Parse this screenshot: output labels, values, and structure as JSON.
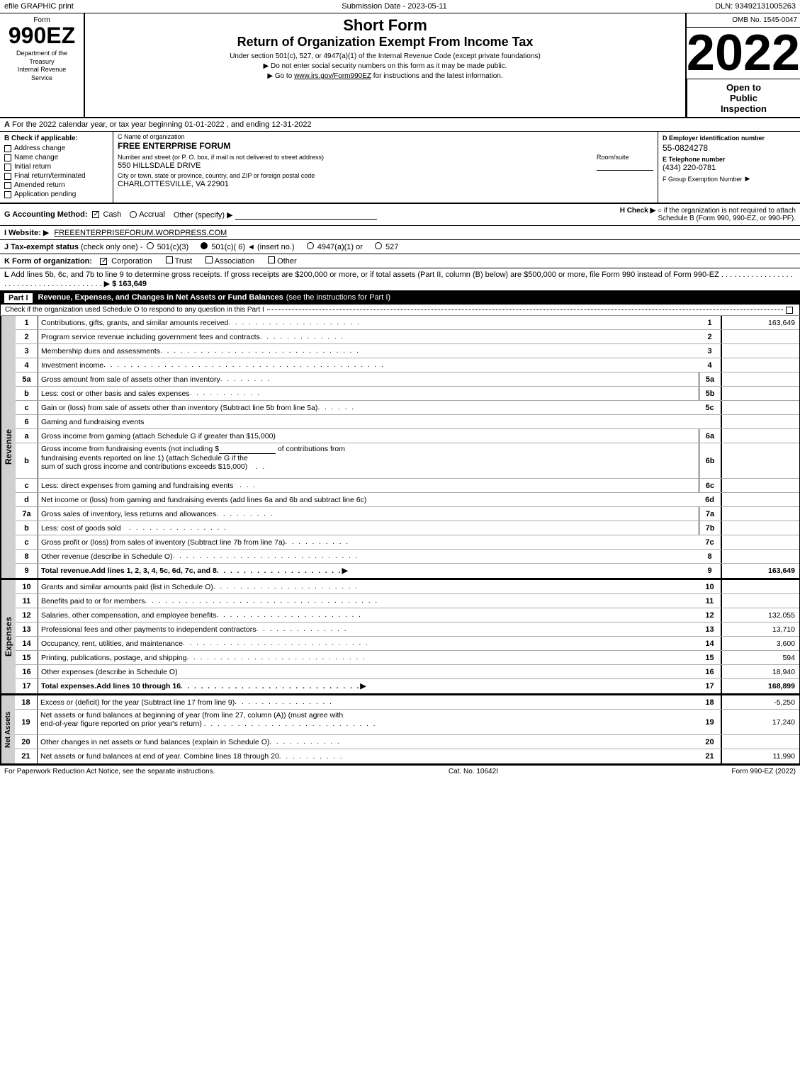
{
  "header": {
    "left": "efile GRAPHIC print",
    "center": "Submission Date - 2023-05-11",
    "right": "DLN: 93492131005263"
  },
  "form": {
    "word": "Form",
    "number": "990EZ",
    "dept_line1": "Department of the",
    "dept_line2": "Treasury",
    "dept_line3": "Internal Revenue",
    "dept_line4": "Service"
  },
  "title": {
    "short_form": "Short Form",
    "return_title": "Return of Organization Exempt From Income Tax",
    "note1": "Under section 501(c), 527, or 4947(a)(1) of the Internal Revenue Code (except private foundations)",
    "note2": "▶ Do not enter social security numbers on this form as it may be made public.",
    "note3": "▶ Go to www.irs.gov/Form990EZ for instructions and the latest information."
  },
  "omb": {
    "label": "OMB No. 1545-0047"
  },
  "year": {
    "value": "2022"
  },
  "open_inspection": {
    "line1": "Open to",
    "line2": "Public",
    "line3": "Inspection"
  },
  "section_a": {
    "label": "A",
    "text": "For the 2022 calendar year, or tax year beginning 01-01-2022 , and ending 12-31-2022"
  },
  "check_b": {
    "title": "B Check if applicable:",
    "items": [
      {
        "label": "Address change",
        "checked": false
      },
      {
        "label": "Name change",
        "checked": false
      },
      {
        "label": "Initial return",
        "checked": false
      },
      {
        "label": "Final return/terminated",
        "checked": false
      },
      {
        "label": "Amended return",
        "checked": false
      },
      {
        "label": "Application pending",
        "checked": false
      }
    ]
  },
  "org": {
    "name_label": "C Name of organization",
    "name": "FREE ENTERPRISE FORUM",
    "address_label": "Number and street (or P. O. box, if mail is not delivered to street address)",
    "address": "550 HILLSDALE DRIVE",
    "room_suite_label": "Room/suite",
    "room_suite": "",
    "city_label": "City or town, state or province, country, and ZIP or foreign postal code",
    "city": "CHARLOTTESVILLE, VA  22901"
  },
  "employer": {
    "label": "D Employer identification number",
    "value": "55-0824278",
    "phone_label": "E Telephone number",
    "phone": "(434) 220-0781",
    "group_exempt_label": "F Group Exemption Number",
    "group_exempt_arrow": "▶"
  },
  "accounting": {
    "label": "G Accounting Method:",
    "cash_checked": true,
    "accrual_checked": false,
    "cash_label": "Cash",
    "accrual_label": "Accrual",
    "other_label": "Other (specify) ▶",
    "h_label": "H  Check ▶",
    "h_text": "○ if the organization is not required to attach Schedule B (Form 990, 990-EZ, or 990-PF)."
  },
  "website": {
    "label": "I Website:",
    "arrow": "▶",
    "value": "FREEENTERPRISEFORUM.WORDPRESS.COM"
  },
  "tax_exempt": {
    "label": "J Tax-exempt status",
    "note": "(check only one) -",
    "option501c3": "○ 501(c)(3)",
    "option501c6": "● 501(c)( 6)",
    "insert_no": "◄ (insert no.)",
    "option4947": "○ 4947(a)(1) or",
    "option527": "○ 527"
  },
  "form_org": {
    "label": "K Form of organization:",
    "corporation_checked": true,
    "trust_checked": false,
    "association_checked": false,
    "other_checked": false,
    "options": [
      "Corporation",
      "Trust",
      "Association",
      "Other"
    ]
  },
  "line_l": {
    "text": "L Add lines 5b, 6c, and 7b to line 9 to determine gross receipts. If gross receipts are $200,000 or more, or if total assets (Part II, column (B) below) are $500,000 or more, file Form 990 instead of Form 990-EZ",
    "dots": ". . . . . . . . . . . . . . . . . . . . . . . . . . . . . . . . . . . . . . . . .",
    "arrow": "▶",
    "value": "$ 163,649"
  },
  "part1": {
    "label": "Part I",
    "title": "Revenue, Expenses, and Changes in Net Assets or Fund Balances",
    "subtitle": "(see the instructions for Part I)",
    "check_note": "Check if the organization used Schedule O to respond to any question in this Part I",
    "rows": [
      {
        "num": "1",
        "desc": "Contributions, gifts, grants, and similar amounts received",
        "dots": true,
        "value": "163,649",
        "bold": false
      },
      {
        "num": "2",
        "desc": "Program service revenue including government fees and contracts",
        "dots": true,
        "value": "",
        "bold": false
      },
      {
        "num": "3",
        "desc": "Membership dues and assessments",
        "dots": true,
        "value": "",
        "bold": false
      },
      {
        "num": "4",
        "desc": "Investment income",
        "dots": true,
        "value": "",
        "bold": false
      },
      {
        "num": "5a",
        "desc": "Gross amount from sale of assets other than inventory",
        "mid_label": "5a",
        "mid_value": "",
        "dots": true,
        "value": "",
        "bold": false
      },
      {
        "num": "b",
        "desc": "Less: cost or other basis and sales expenses",
        "mid_label": "5b",
        "mid_value": "",
        "dots": true,
        "value": "",
        "bold": false
      },
      {
        "num": "c",
        "desc": "Gain or (loss) from sale of assets other than inventory (Subtract line 5b from line 5a)",
        "dots": true,
        "value": "",
        "bold": false,
        "line_num_right": "5c"
      },
      {
        "num": "6",
        "desc": "Gaming and fundraising events",
        "value": "",
        "bold": false
      },
      {
        "num": "a",
        "desc": "Gross income from gaming (attach Schedule G if greater than $15,000)",
        "mid_label": "6a",
        "mid_value": "",
        "dots": false,
        "value": "",
        "bold": false
      },
      {
        "num": "b",
        "desc": "Gross income from fundraising events (not including $_______________of contributions from fundraising events reported on line 1) (attach Schedule G if the sum of such gross income and contributions exceeds $15,000)",
        "mid_label": "6b",
        "mid_value": "",
        "dots": false,
        "value": "",
        "bold": false
      },
      {
        "num": "c",
        "desc": "Less: direct expenses from gaming and fundraising events",
        "mid_label": "6c",
        "mid_value": "",
        "dots": false,
        "value": "",
        "bold": false
      },
      {
        "num": "d",
        "desc": "Net income or (loss) from gaming and fundraising events (add lines 6a and 6b and subtract line 6c)",
        "dots": false,
        "value": "",
        "bold": false,
        "line_num_right": "6d"
      },
      {
        "num": "7a",
        "desc": "Gross sales of inventory, less returns and allowances",
        "mid_label": "7a",
        "mid_value": "",
        "dots": true,
        "value": "",
        "bold": false
      },
      {
        "num": "b",
        "desc": "Less: cost of goods sold",
        "mid_label": "7b",
        "mid_value": "",
        "dots": true,
        "value": "",
        "bold": false
      },
      {
        "num": "c",
        "desc": "Gross profit or (loss) from sales of inventory (Subtract line 7b from line 7a)",
        "dots": true,
        "value": "",
        "bold": false,
        "line_num_right": "7c"
      },
      {
        "num": "8",
        "desc": "Other revenue (describe in Schedule O)",
        "dots": true,
        "value": "",
        "bold": false
      },
      {
        "num": "9",
        "desc": "Total revenue. Add lines 1, 2, 3, 4, 5c, 6d, 7c, and 8",
        "dots": true,
        "value": "163,649",
        "bold": true,
        "arrow": "▶"
      }
    ]
  },
  "expenses_rows": [
    {
      "num": "10",
      "desc": "Grants and similar amounts paid (list in Schedule O)",
      "dots": true,
      "value": "",
      "bold": false
    },
    {
      "num": "11",
      "desc": "Benefits paid to or for members",
      "dots": true,
      "value": "",
      "bold": false
    },
    {
      "num": "12",
      "desc": "Salaries, other compensation, and employee benefits",
      "dots": true,
      "value": "132,055",
      "bold": false
    },
    {
      "num": "13",
      "desc": "Professional fees and other payments to independent contractors",
      "dots": true,
      "value": "13,710",
      "bold": false
    },
    {
      "num": "14",
      "desc": "Occupancy, rent, utilities, and maintenance",
      "dots": true,
      "value": "3,600",
      "bold": false
    },
    {
      "num": "15",
      "desc": "Printing, publications, postage, and shipping",
      "dots": true,
      "value": "594",
      "bold": false
    },
    {
      "num": "16",
      "desc": "Other expenses (describe in Schedule O)",
      "dots": false,
      "value": "18,940",
      "bold": false
    },
    {
      "num": "17",
      "desc": "Total expenses. Add lines 10 through 16",
      "dots": true,
      "value": "168,899",
      "bold": true,
      "arrow": "▶"
    }
  ],
  "net_assets_rows": [
    {
      "num": "18",
      "desc": "Excess or (deficit) for the year (Subtract line 17 from line 9)",
      "dots": true,
      "value": "-5,250",
      "bold": false
    },
    {
      "num": "19",
      "desc": "Net assets or fund balances at beginning of year (from line 27, column (A)) (must agree with end-of-year figure reported on prior year's return)",
      "dots": true,
      "value": "17,240",
      "bold": false
    },
    {
      "num": "20",
      "desc": "Other changes in net assets or fund balances (explain in Schedule O)",
      "dots": true,
      "value": "",
      "bold": false
    },
    {
      "num": "21",
      "desc": "Net assets or fund balances at end of year. Combine lines 18 through 20",
      "dots": true,
      "value": "11,990",
      "bold": false
    }
  ],
  "footer": {
    "left": "For Paperwork Reduction Act Notice, see the separate instructions.",
    "center": "Cat. No. 10642I",
    "right": "Form 990-EZ (2022)"
  }
}
